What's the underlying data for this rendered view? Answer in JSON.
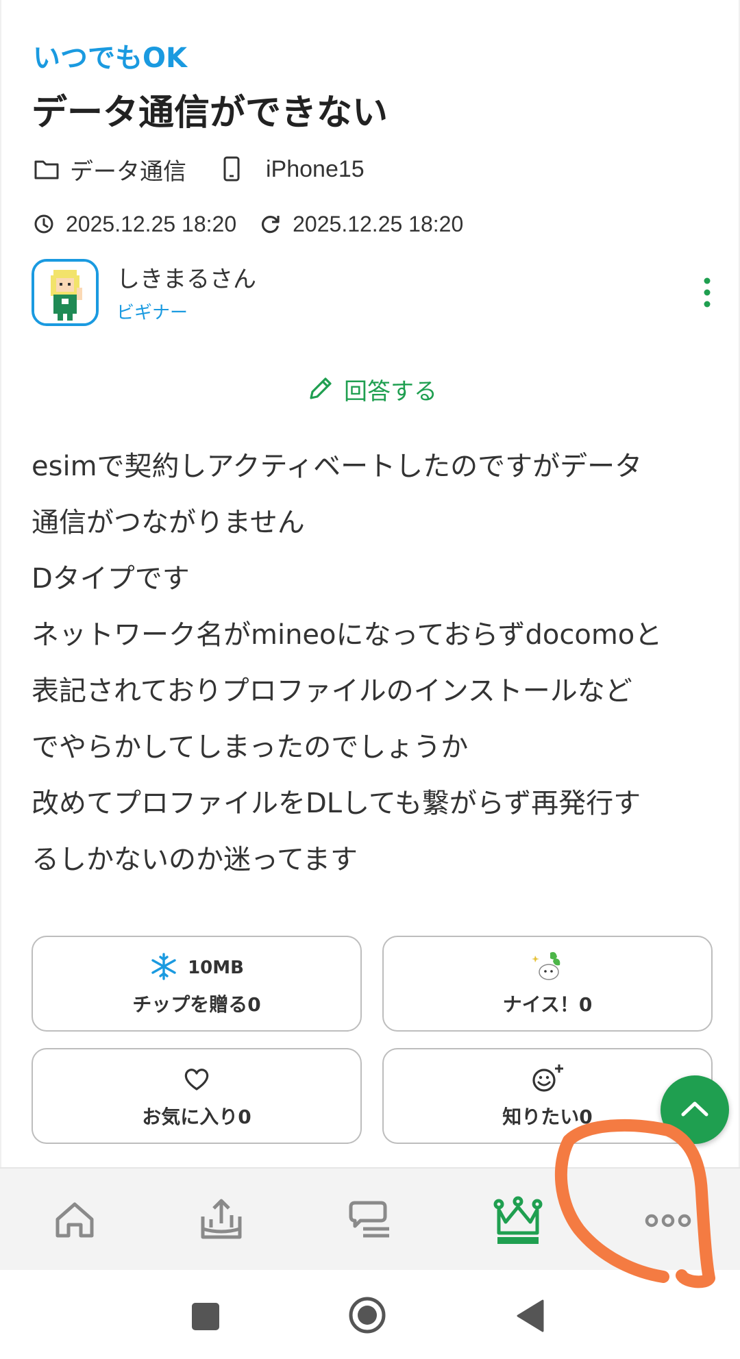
{
  "question": {
    "tag": "いつでもOK",
    "title": "データ通信ができない",
    "category": "データ通信",
    "device": "iPhone15",
    "posted": "2025.12.25 18:20",
    "updated": "2025.12.25 18:20"
  },
  "user": {
    "name": "しきまるさん",
    "rank": "ビギナー"
  },
  "answer_label": "回答する",
  "body_lines": [
    "esimで契約しアクティベートしたのですがデータ",
    "通信がつながりません",
    "Dタイプです",
    "ネットワーク名がmineoになっておらずdocomoと",
    "表記されておりプロファイルのインストールなど",
    "でやらかしてしまったのでしょうか",
    "改めてプロファイルをDLしても繋がらず再発行す",
    "るしかないのか迷ってます"
  ],
  "reactions": {
    "tip_amount": "10MB",
    "tip_label": "チップを贈る0",
    "nice_label": "ナイス！0",
    "favorite_label": "お気に入り0",
    "want_to_know_label": "知りたい0"
  },
  "icons": {
    "category": "folder-icon",
    "device": "smartphone-icon",
    "posted": "clock-icon",
    "updated": "refresh-icon",
    "answer": "pencil-icon",
    "tip": "snowflake-icon",
    "nice": "mascot-icon",
    "favorite": "heart-icon",
    "want_to_know": "smiley-plus-icon",
    "scroll_top": "chevron-up-icon",
    "nav": [
      "home-icon",
      "upload-icon",
      "chat-icon",
      "crown-icon",
      "more-icon"
    ],
    "system": [
      "recents-icon",
      "home-circle-icon",
      "back-icon"
    ]
  },
  "colors": {
    "accent_blue": "#1a9ae0",
    "accent_green": "#1f9f50",
    "nav_gray": "#8a8a8a",
    "annotation_orange": "#f47b42"
  }
}
